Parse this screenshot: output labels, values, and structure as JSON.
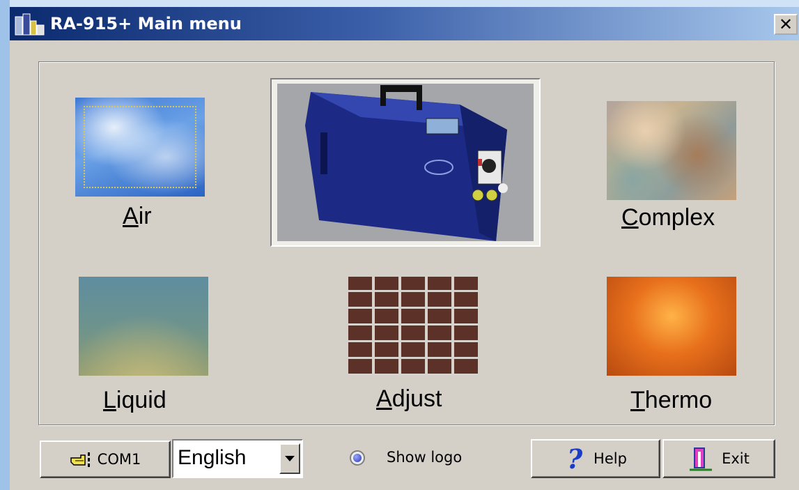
{
  "window": {
    "title": "RA-915+ Main menu",
    "close_glyph": "✕",
    "icon": "app-icon"
  },
  "tiles": {
    "air": {
      "label": "Air",
      "accesskey": "A",
      "rest": "ir",
      "image": "sky-image"
    },
    "device": {
      "image": "analyzer-device-image"
    },
    "complex": {
      "label": "Complex",
      "accesskey": "C",
      "rest": "omplex",
      "image": "marble-image"
    },
    "liquid": {
      "label": "Liquid",
      "accesskey": "L",
      "rest": "iquid",
      "image": "water-image"
    },
    "adjust": {
      "label": "Adjust",
      "accesskey": "A",
      "rest": "djust",
      "image": "brick-image"
    },
    "thermo": {
      "label": "Thermo",
      "accesskey": "T",
      "rest": "hermo",
      "image": "fire-image"
    }
  },
  "footer": {
    "com_button": {
      "label": "COM1",
      "icon": "pointing-hand-icon"
    },
    "language": {
      "selected": "English",
      "icon": "dropdown-arrow-icon"
    },
    "show_logo": {
      "label": "Show logo"
    },
    "help_button": {
      "label": "Help",
      "icon": "question-mark-icon"
    },
    "exit_button": {
      "label": "Exit",
      "icon": "exit-door-icon"
    }
  }
}
